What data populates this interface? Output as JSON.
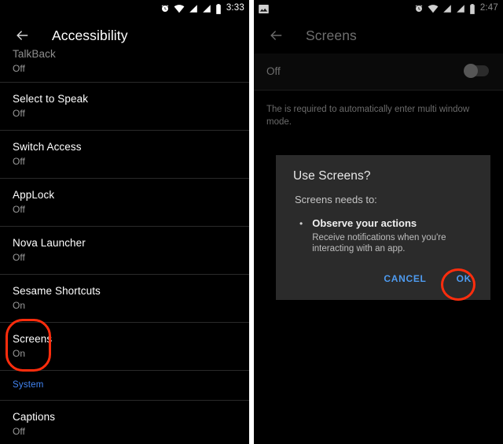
{
  "left_panel": {
    "status_bar": {
      "icons": [
        "alarm-icon",
        "wifi-icon",
        "signal-icon",
        "signal-2-icon",
        "battery-icon"
      ],
      "clock": "3:33"
    },
    "appbar": {
      "back_icon": "back-arrow-icon",
      "title": "Accessibility"
    },
    "items": [
      {
        "title": "TalkBack",
        "sub": "Off",
        "clipped": true
      },
      {
        "title": "Select to Speak",
        "sub": "Off",
        "clipped": false
      },
      {
        "title": "Switch Access",
        "sub": "Off",
        "clipped": false
      },
      {
        "title": "AppLock",
        "sub": "Off",
        "clipped": false
      },
      {
        "title": "Nova Launcher",
        "sub": "Off",
        "clipped": false
      },
      {
        "title": "Sesame Shortcuts",
        "sub": "On",
        "clipped": false
      },
      {
        "title": "Screens",
        "sub": "On",
        "clipped": false
      }
    ],
    "section_header": "System",
    "items_after": [
      {
        "title": "Captions",
        "sub": "Off"
      }
    ]
  },
  "right_panel": {
    "status_bar": {
      "icons": [
        "image-icon",
        "alarm-icon",
        "wifi-icon",
        "signal-icon",
        "signal-2-icon",
        "battery-icon"
      ],
      "clock": "2:47"
    },
    "appbar": {
      "back_icon": "back-arrow-icon",
      "title": "Screens"
    },
    "toggle": {
      "label": "Off",
      "state": "off"
    },
    "description": "The is required to automatically enter multi window mode.",
    "dialog": {
      "title": "Use Screens?",
      "lead": "Screens needs to:",
      "bullets": [
        {
          "title": "Observe your actions",
          "body": "Receive notifications when you're interacting with an app."
        }
      ],
      "cancel_label": "CANCEL",
      "ok_label": "OK"
    }
  },
  "annotations": {
    "accent_color": "#ff2d0d",
    "screens_row_highlight": "rounded-rect",
    "ok_button_highlight": "circle"
  },
  "colors": {
    "background": "#000000",
    "dialog_bg": "#2b2b2b",
    "link_blue": "#4285f4",
    "button_blue": "#4e9bf0",
    "annotation_red": "#ff2d0d"
  }
}
